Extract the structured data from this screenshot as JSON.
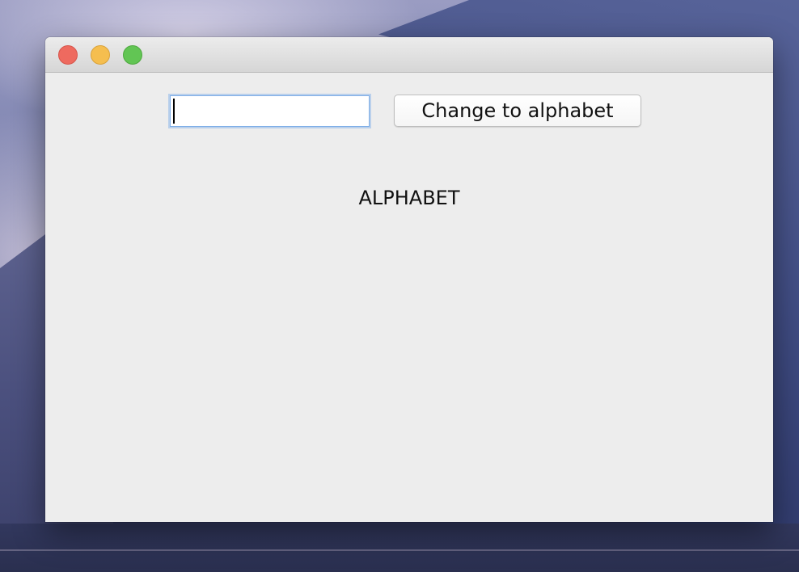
{
  "window": {
    "title": "",
    "controls": {
      "close_color": "#ee6a5f",
      "minimize_color": "#f5be4f",
      "zoom_color": "#62c554"
    }
  },
  "form": {
    "input_value": "",
    "button_label": "Change to alphabet",
    "result_text": "ALPHABET"
  }
}
